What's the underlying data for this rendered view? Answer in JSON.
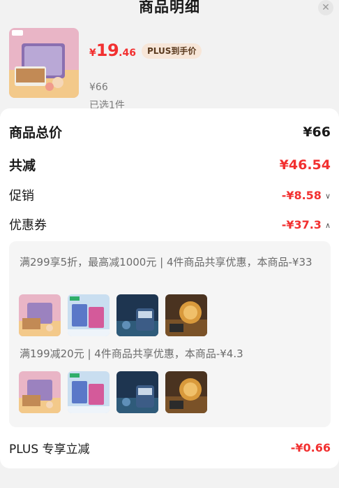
{
  "header": {
    "title": "商品明细",
    "close_icon": "close-icon"
  },
  "product": {
    "price_currency": "¥",
    "price_int": "19",
    "price_dec": ".46",
    "plus_badge": "PLUS到手价",
    "original_price": "¥66",
    "selected": "已选1件"
  },
  "summary": {
    "total_label": "商品总价",
    "total_value": "¥66",
    "reduce_label": "共减",
    "reduce_value": "¥46.54",
    "promo_label": "促销",
    "promo_value": "-¥8.58",
    "coupon_label": "优惠券",
    "coupon_value": "-¥37.3"
  },
  "coupons": [
    {
      "text": "满299享5折，最高减1000元 | 4件商品共享优惠，本商品-¥33"
    },
    {
      "text": "满199减20元 | 4件商品共享优惠，本商品-¥4.3"
    }
  ],
  "plus": {
    "label": "PLUS 专享立减",
    "value": "-¥0.66"
  },
  "colors": {
    "accent_red": "#f23030",
    "badge_bg": "#f7e6d8"
  }
}
